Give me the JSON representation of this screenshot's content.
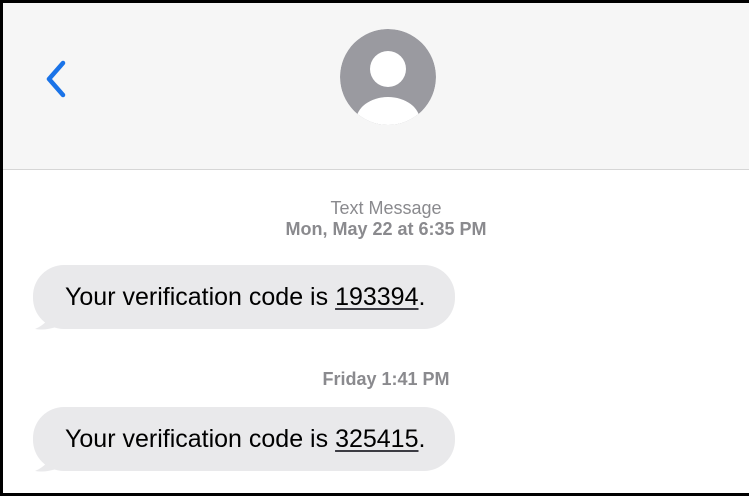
{
  "header": {
    "back_icon": "chevron-left-icon",
    "avatar_icon": "person-avatar-icon",
    "accent_color": "#1a73e8"
  },
  "thread": {
    "messages": [
      {
        "timestamp_label": "Text Message",
        "timestamp": "Mon, May 22 at 6:35 PM",
        "text_prefix": "Your verification code is ",
        "code": "193394",
        "text_suffix": "."
      },
      {
        "timestamp": "Friday 1:41 PM",
        "text_prefix": "Your verification code is ",
        "code": "325415",
        "text_suffix": "."
      }
    ]
  }
}
